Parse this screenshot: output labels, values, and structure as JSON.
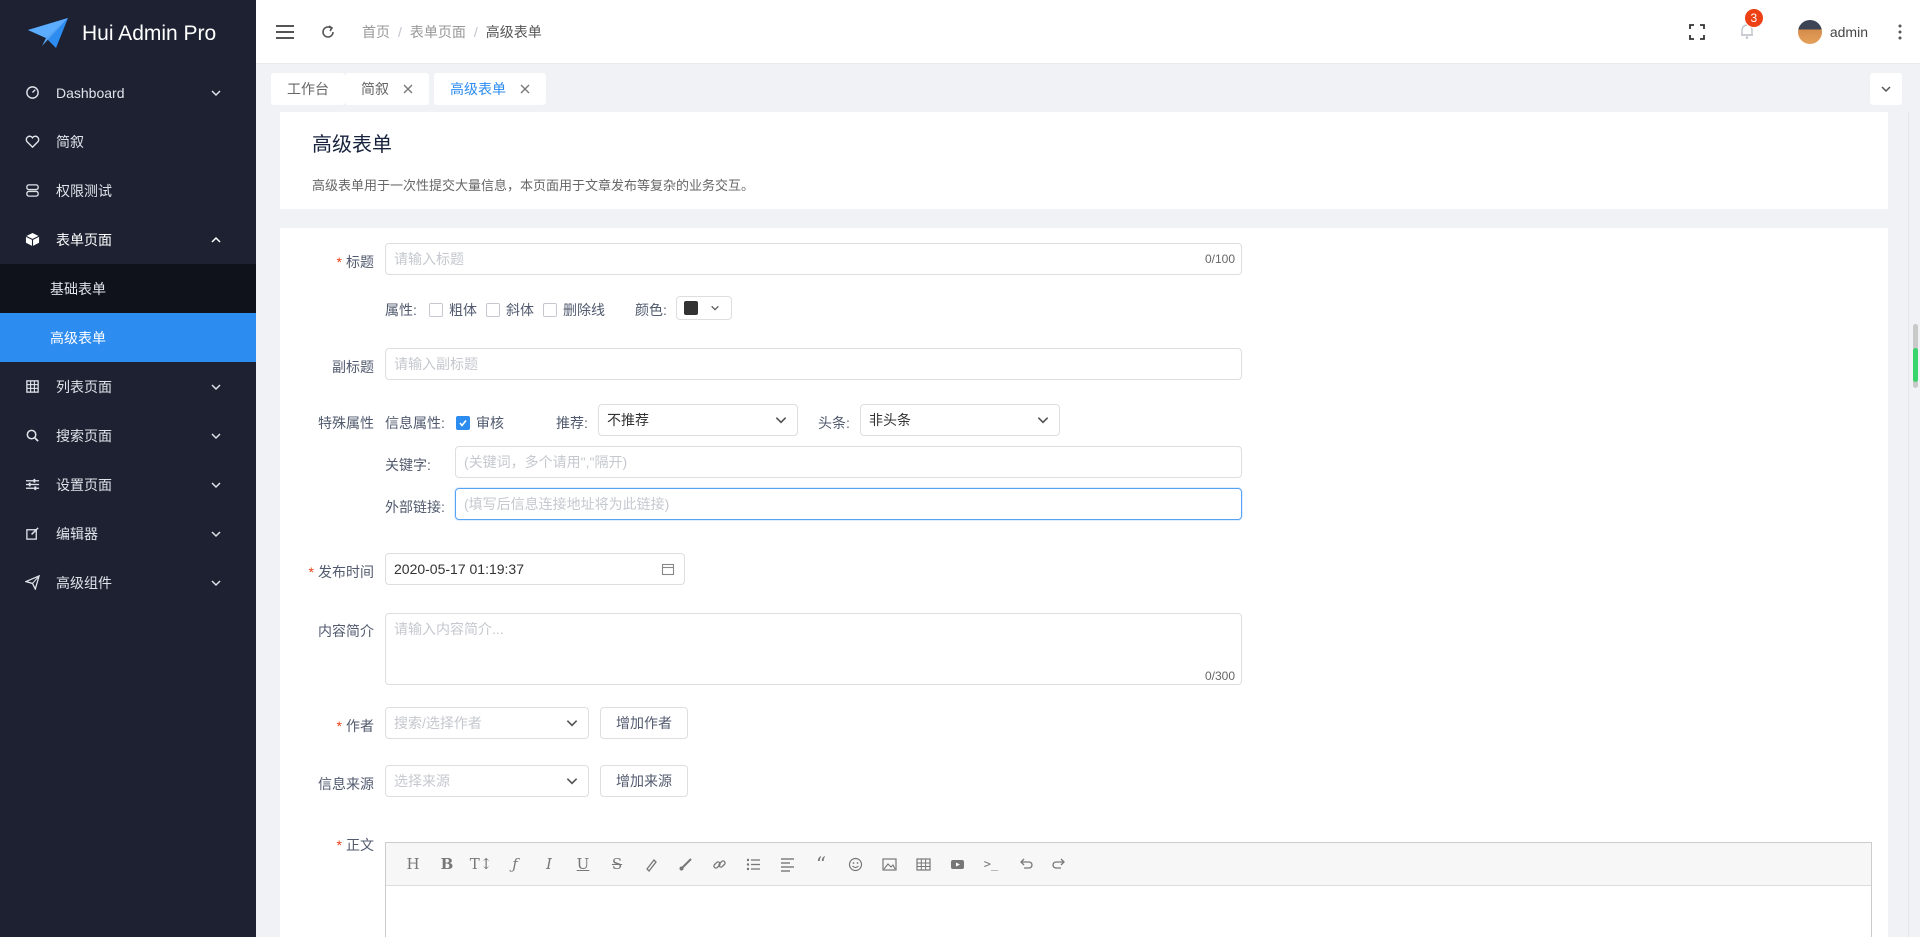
{
  "app": {
    "title": "Hui Admin Pro"
  },
  "sidebar": {
    "items": [
      {
        "label": "Dashboard",
        "icon": "dashboard-icon",
        "has_arrow": true
      },
      {
        "label": "简叙",
        "icon": "heart-icon",
        "has_arrow": false
      },
      {
        "label": "权限测试",
        "icon": "database-icon",
        "has_arrow": false
      },
      {
        "label": "表单页面",
        "icon": "cube-icon",
        "has_arrow": true,
        "open": true
      },
      {
        "label": "列表页面",
        "icon": "grid-icon",
        "has_arrow": true
      },
      {
        "label": "搜索页面",
        "icon": "search-icon",
        "has_arrow": true
      },
      {
        "label": "设置页面",
        "icon": "sliders-icon",
        "has_arrow": true
      },
      {
        "label": "编辑器",
        "icon": "edit-icon",
        "has_arrow": true
      },
      {
        "label": "高级组件",
        "icon": "send-icon",
        "has_arrow": true
      }
    ],
    "subitems": [
      {
        "label": "基础表单",
        "active": false
      },
      {
        "label": "高级表单",
        "active": true
      }
    ]
  },
  "header": {
    "breadcrumb": [
      "首页",
      "表单页面",
      "高级表单"
    ],
    "notification_count": "3",
    "username": "admin"
  },
  "tabs": [
    {
      "label": "工作台",
      "closable": false,
      "active": false
    },
    {
      "label": "简叙",
      "closable": true,
      "active": false
    },
    {
      "label": "高级表单",
      "closable": true,
      "active": true
    }
  ],
  "page": {
    "title": "高级表单",
    "description": "高级表单用于一次性提交大量信息，本页面用于文章发布等复杂的业务交互。"
  },
  "form": {
    "title": {
      "label": "标题",
      "placeholder": "请输入标题",
      "count": "0/100"
    },
    "attrs": {
      "label": "属性:",
      "bold": "粗体",
      "italic": "斜体",
      "strike": "删除线",
      "color_label": "颜色:",
      "color_value": "#333333"
    },
    "subtitle": {
      "label": "副标题",
      "placeholder": "请输入副标题"
    },
    "special": {
      "label": "特殊属性",
      "info_attr_label": "信息属性:",
      "review_label": "审核",
      "review_checked": true,
      "recommend_label": "推荐:",
      "recommend_value": "不推荐",
      "headline_label": "头条:",
      "headline_value": "非头条",
      "keyword_label": "关键字:",
      "keyword_placeholder": "(关键词，多个请用\",\"隔开)",
      "link_label": "外部链接:",
      "link_placeholder": "(填写后信息连接地址将为此链接)"
    },
    "publish_time": {
      "label": "发布时间",
      "value": "2020-05-17 01:19:37"
    },
    "summary": {
      "label": "内容简介",
      "placeholder": "请输入内容简介...",
      "count": "0/300"
    },
    "author": {
      "label": "作者",
      "placeholder": "搜索/选择作者",
      "button": "增加作者"
    },
    "source": {
      "label": "信息来源",
      "placeholder": "选择来源",
      "button": "增加来源"
    },
    "body": {
      "label": "正文"
    }
  },
  "editor_toolbar": [
    "H",
    "B",
    "TI",
    "F",
    "I",
    "U",
    "S",
    "brush",
    "paint",
    "link",
    "list",
    "align",
    "quote",
    "emoji",
    "image",
    "table",
    "video",
    "code",
    "undo",
    "redo"
  ],
  "colors": {
    "sidebar_bg": "#1d2131",
    "accent": "#2d8cf0",
    "badge": "#ed4014",
    "required": "#ed4014"
  }
}
